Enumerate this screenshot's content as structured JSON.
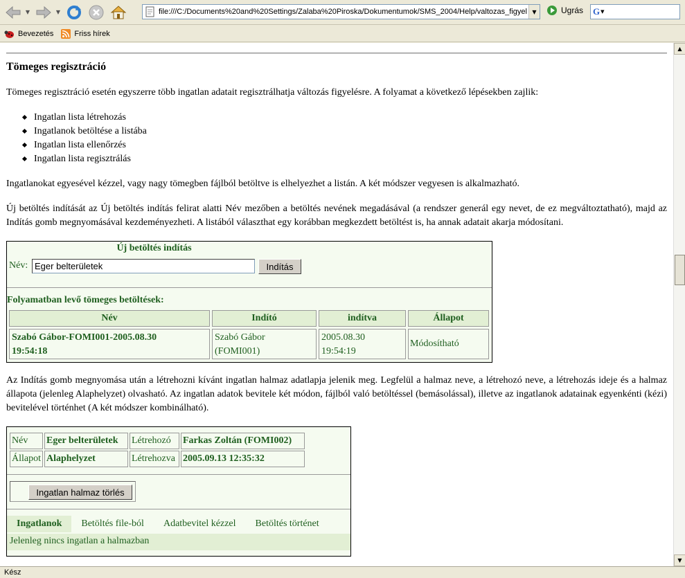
{
  "toolbar": {
    "url": "file:///C:/Documents%20and%20Settings/Zalaba%20Piroska/Dokumentumok/SMS_2004/Help/valtozas_figyel",
    "go_label": "Ugrás",
    "search_value": ""
  },
  "bookmarks": [
    {
      "label": "Bevezetés",
      "icon": "ladybug-icon"
    },
    {
      "label": "Friss hírek",
      "icon": "rss-icon"
    }
  ],
  "page": {
    "title": "Tömeges regisztráció",
    "intro": "Tömeges regisztráció esetén egyszerre több ingatlan adatait regisztrálhatja változás figyelésre. A folyamat a következő lépésekben zajlik:",
    "steps": [
      "Ingatlan lista létrehozás",
      "Ingatlanok betöltése a listába",
      "Ingatlan lista ellenőrzés",
      "Ingatlan lista regisztrálás"
    ],
    "para2": "Ingatlanokat egyesével kézzel, vagy nagy tömegben fájlból betöltve is elhelyezhet a listán. A két módszer vegyesen is alkalmazható.",
    "para3": "Új betöltés indítását az Új betöltés indítás felirat alatti Név mezőben a betöltés nevének megadásával (a rendszer generál egy nevet, de ez megváltoztatható), majd az Indítás gomb megnyomásával kezdeményezheti. A listából választhat egy korábban megkezdett betöltést is, ha annak adatait akarja módosítani.",
    "para4": "Az Indítás gomb megnyomása után a létrehozni kívánt ingatlan halmaz adatlapja jelenik meg. Legfelül a halmaz neve, a létrehozó neve, a létrehozás ideje és a halmaz állapota (jelenleg Alaphelyzet) olvasható. Az ingatlan adatok bevitele két módon, fájlból való betöltéssel (bemásolással), illetve az ingatlanok adatainak egyenkénti (kézi) bevitelével történhet (A két módszer kombinálható)."
  },
  "panel1": {
    "header": "Új betöltés indítás",
    "name_label": "Név:",
    "name_value": "Eger belterületek",
    "start_button": "Indítás",
    "inprogress_title": "Folyamatban levő tömeges betöltések:",
    "columns": [
      "Név",
      "Indító",
      "indítva",
      "Állapot"
    ],
    "row": {
      "name_line1": "Szabó Gábor-FOMI001-2005.08.30",
      "name_line2": "19:54:18",
      "starter_line1": "Szabó Gábor",
      "starter_line2": "(FOMI001)",
      "started_line1": "2005.08.30",
      "started_line2": "19:54:19",
      "status": "Módosítható"
    }
  },
  "panel2": {
    "name_label": "Név",
    "name_value": "Eger belterületek",
    "creator_label": "Létrehozó",
    "creator_value": "Farkas Zoltán (FOMI002)",
    "state_label": "Állapot",
    "state_value": "Alaphelyzet",
    "created_label": "Létrehozva",
    "created_value": "2005.09.13 12:35:32",
    "delete_button": "Ingatlan halmaz törlés",
    "tabs": [
      "Ingatlanok",
      "Betöltés file-ból",
      "Adatbevitel kézzel",
      "Betöltés történet"
    ],
    "empty_message": "Jelenleg nincs ingatlan a halmazban"
  },
  "status": "Kész"
}
